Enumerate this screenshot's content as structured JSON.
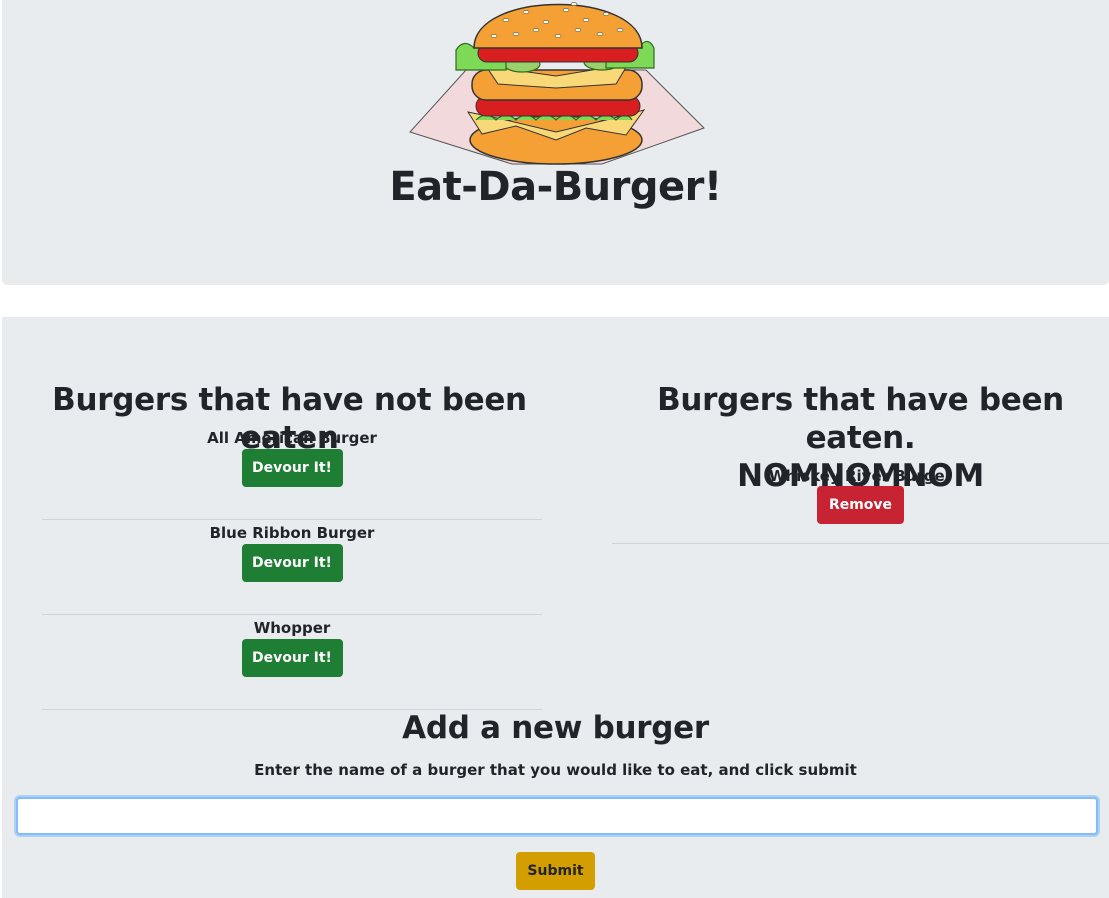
{
  "header": {
    "title": "Eat-Da-Burger!",
    "logo_icon": "burger-icon"
  },
  "uneaten": {
    "title": "Burgers that have not been eaten",
    "button_label": "Devour It!",
    "items": [
      {
        "name": "All American Burger"
      },
      {
        "name": "Blue Ribbon Burger"
      },
      {
        "name": "Whopper"
      }
    ]
  },
  "eaten": {
    "title_line1": "Burgers that have been eaten.",
    "title_line2": "NOMNOMNOM",
    "button_label": "Remove",
    "items": [
      {
        "name": "Whiskey River Burger"
      }
    ]
  },
  "add_form": {
    "title": "Add a new burger",
    "hint": "Enter the name of a burger that you would like to eat, and click submit",
    "input_value": "",
    "input_placeholder": "",
    "submit_label": "Submit"
  },
  "colors": {
    "background": "#e9ecef",
    "devour": "#1e7e34",
    "remove": "#c82333",
    "submit": "#d39e00"
  }
}
